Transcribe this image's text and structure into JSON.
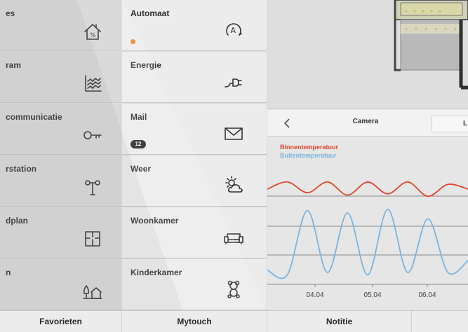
{
  "tiles": {
    "col1": [
      {
        "label": "es",
        "icon": "house-percent-icon"
      },
      {
        "label": "ram",
        "icon": "chart-lines-icon"
      },
      {
        "label": "communicatie",
        "icon": "key-icon"
      },
      {
        "label": "rstation",
        "icon": "weather-station-icon"
      },
      {
        "label": "dplan",
        "icon": "floorplan-icon"
      },
      {
        "label": "n",
        "icon": "trees-house-icon"
      }
    ],
    "col2": [
      {
        "label": "Automaat",
        "icon": "automatic-a-icon"
      },
      {
        "label": "Energie",
        "icon": "plug-icon"
      },
      {
        "label": "Mail",
        "icon": "envelope-icon",
        "badge": "12"
      },
      {
        "label": "Weer",
        "icon": "sun-cloud-icon"
      },
      {
        "label": "Woonkamer",
        "icon": "sofa-icon"
      },
      {
        "label": "Kinderkamer",
        "icon": "teddy-bear-icon"
      }
    ]
  },
  "panel": {
    "toolbar": {
      "camera_label": "Camera",
      "next_label": "L"
    },
    "legend": {
      "inside": "Binnentemperatuur",
      "outside": "Buitentemperatuur"
    }
  },
  "bottom_tabs": [
    "Favorieten",
    "Mytouch",
    "Notitie"
  ],
  "colors": {
    "inside": "#e0452c",
    "outside": "#7ab4e0",
    "status_dot": "#e8872b"
  },
  "chart_data": {
    "type": "line",
    "x_tick_labels": [
      "04.04",
      "05.04",
      "06.04"
    ],
    "series": [
      {
        "name": "Binnentemperatuur",
        "color": "#e0452c",
        "values": [
          0.8,
          0.86,
          0.77,
          0.86,
          0.75,
          0.86,
          0.76,
          0.86,
          0.74,
          0.84,
          0.8
        ]
      },
      {
        "name": "Buitentemperatuur",
        "color": "#7ab4e0",
        "values": [
          0.12,
          0.08,
          0.62,
          0.1,
          0.6,
          0.08,
          0.63,
          0.1,
          0.55,
          0.1,
          0.2
        ]
      }
    ],
    "grid": true
  }
}
